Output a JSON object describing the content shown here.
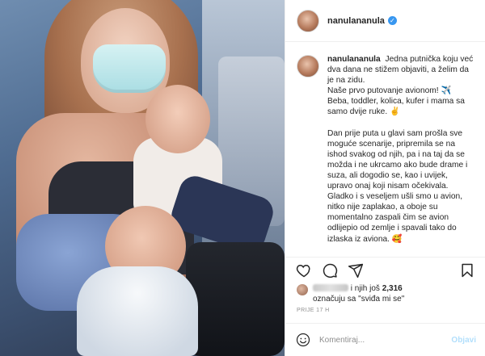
{
  "post": {
    "username": "nanulananula",
    "verified": true,
    "photo_alt": "Mother with face mask holding toddler and baby on airplane"
  },
  "caption": {
    "username": "nanulananula",
    "lines_p1": [
      "Jedna putnička koju već dva dana ne stižem objaviti, a želim da je na zidu.",
      "Naše prvo putovanje avionom! ✈️",
      "Beba, toddler, kolica, kufer i mama sa samo dvije ruke. ✌️"
    ],
    "paragraph2": "Dan prije puta u glavi sam prošla sve moguće scenarije, pripremila se na ishod svakog od njih, pa i na taj da se možda i ne ukrcamo ako bude drame i suza, ali dogodio se, kao i uvijek, upravo onaj koji nisam očekivala. Gladko i s veseljem ušli smo u avion, nitko nije zaplakao, a oboje su momentalno zaspali čim se avion odlijepio od zemlje i spavali tako do izlaska iz aviona. 🥰"
  },
  "actions": {
    "icons": [
      "heart-icon",
      "comment-icon",
      "share-icon",
      "bookmark-icon"
    ]
  },
  "likes": {
    "prefix": "i njih još",
    "count": "2,316",
    "suffix": "označuju sa \"sviđa mi se\""
  },
  "timestamp": "PRIJE 17 H",
  "comment_box": {
    "placeholder": "Komentiraj...",
    "post_label": "Objavi"
  },
  "colors": {
    "verified": "#3897f0",
    "post_button_disabled": "#b2dffc",
    "text": "#262626",
    "muted": "#8e8e8e"
  }
}
